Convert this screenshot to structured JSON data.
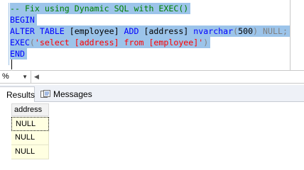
{
  "editor": {
    "lines": [
      {
        "parts": [
          {
            "t": "-- Fix using Dynamic SQL with EXEC()",
            "c": "cm"
          }
        ]
      },
      {
        "parts": [
          {
            "t": "BEGIN",
            "c": "kw"
          }
        ]
      },
      {
        "parts": [
          {
            "t": "ALTER TABLE ",
            "c": "kw"
          },
          {
            "t": "[employee] ",
            "c": "bk"
          },
          {
            "t": "ADD ",
            "c": "kw"
          },
          {
            "t": "[address] ",
            "c": "bk"
          },
          {
            "t": "nvarchar",
            "c": "kw"
          },
          {
            "t": "(",
            "c": "gr"
          },
          {
            "t": "500",
            "c": "bk"
          },
          {
            "t": ") ",
            "c": "gr"
          },
          {
            "t": "NULL",
            "c": "gr"
          },
          {
            "t": ";",
            "c": "gr"
          }
        ]
      },
      {
        "parts": [
          {
            "t": "EXEC",
            "c": "kw"
          },
          {
            "t": "(",
            "c": "gr"
          },
          {
            "t": "'select [address] from [employee]'",
            "c": "str"
          },
          {
            "t": ")",
            "c": "gr"
          }
        ]
      },
      {
        "parts": [
          {
            "t": "END",
            "c": "kw"
          }
        ]
      }
    ]
  },
  "status": {
    "zoom": "%"
  },
  "tabs": {
    "results": "Results",
    "messages": "Messages"
  },
  "grid": {
    "column": "address",
    "rows": [
      "NULL",
      "NULL",
      "NULL"
    ]
  }
}
